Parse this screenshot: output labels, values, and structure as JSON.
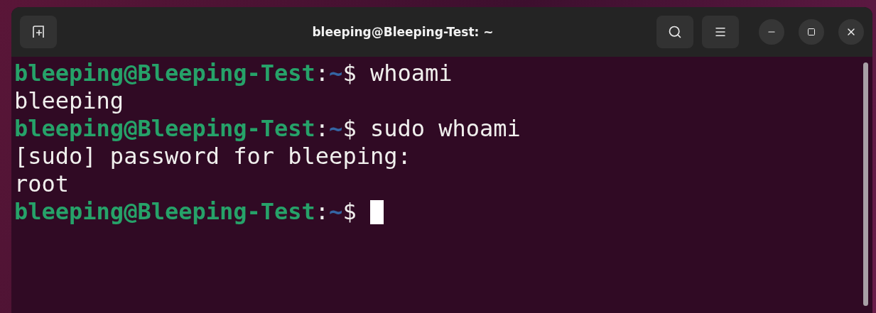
{
  "window": {
    "title": "bleeping@Bleeping-Test: ~"
  },
  "terminal": {
    "lines": [
      {
        "kind": "prompt",
        "user_host": "bleeping@Bleeping-Test",
        "separator": ":",
        "path": "~",
        "symbol": "$",
        "command": "whoami",
        "cursor": false
      },
      {
        "kind": "output",
        "text": "bleeping"
      },
      {
        "kind": "prompt",
        "user_host": "bleeping@Bleeping-Test",
        "separator": ":",
        "path": "~",
        "symbol": "$",
        "command": "sudo whoami",
        "cursor": false
      },
      {
        "kind": "output",
        "text": "[sudo] password for bleeping:"
      },
      {
        "kind": "output",
        "text": "root"
      },
      {
        "kind": "prompt",
        "user_host": "bleeping@Bleeping-Test",
        "separator": ":",
        "path": "~",
        "symbol": "$",
        "cursor": true
      }
    ]
  }
}
